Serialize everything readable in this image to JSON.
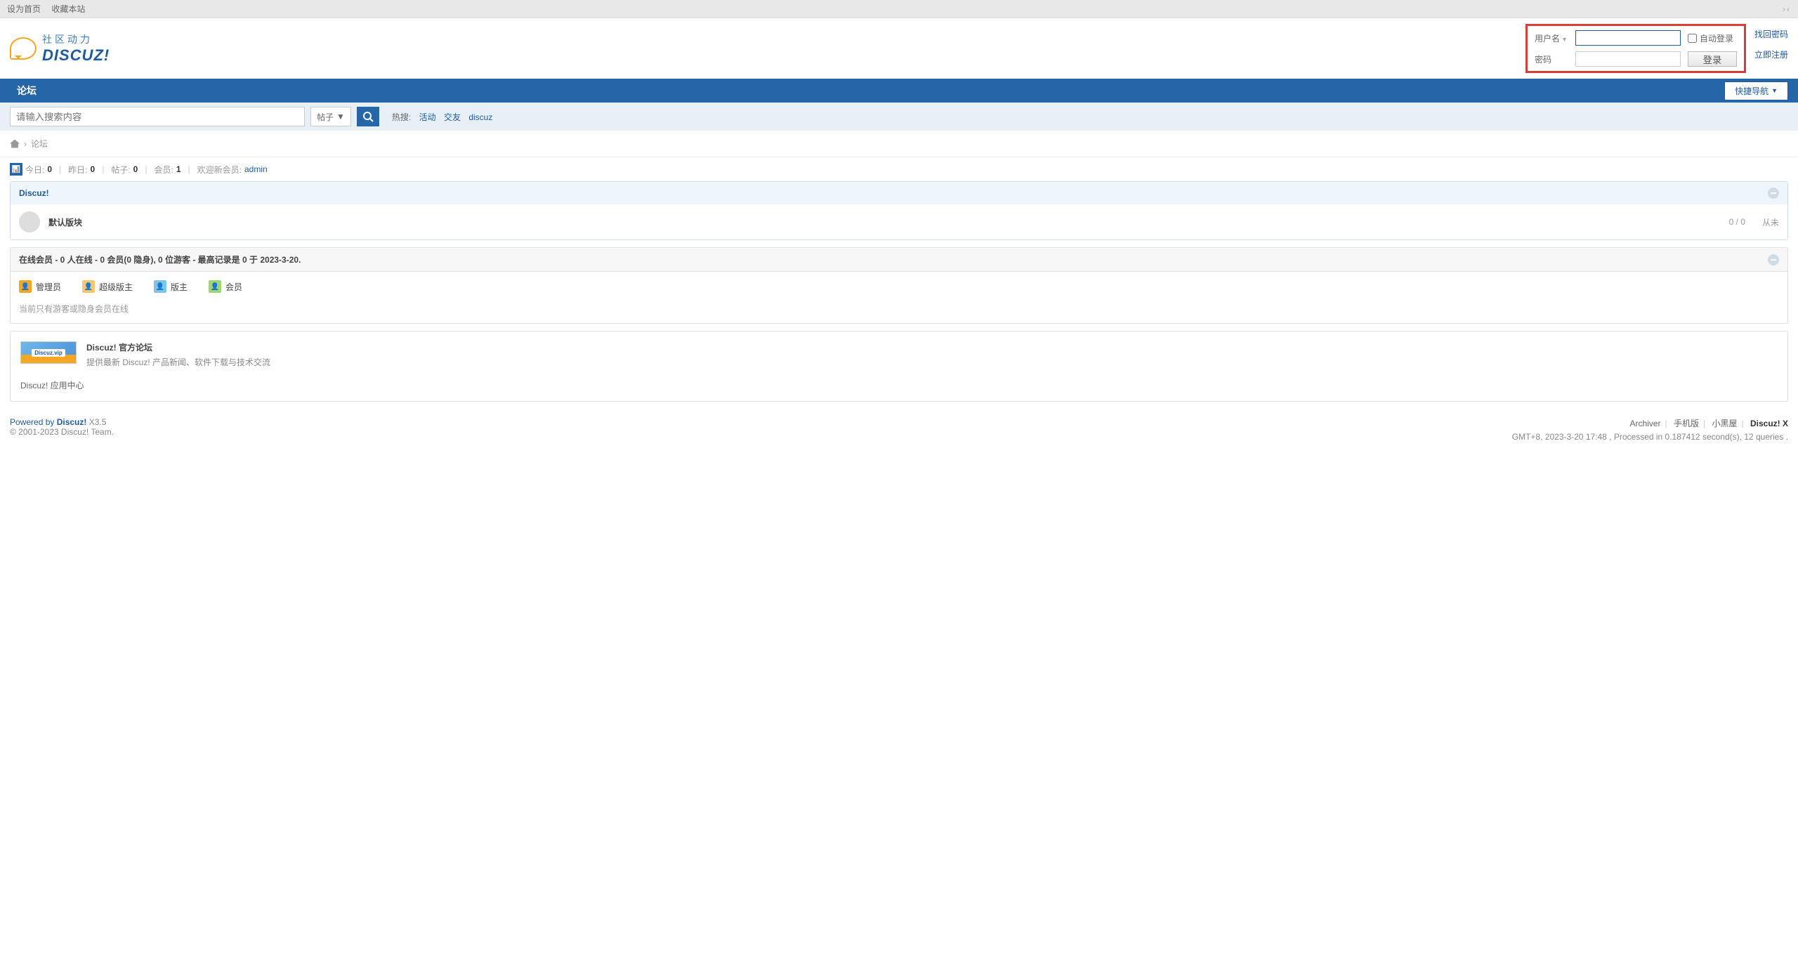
{
  "topbar": {
    "set_home": "设为首页",
    "favorite": "收藏本站",
    "toggle": "›‹"
  },
  "logo": {
    "cn": "社区动力",
    "en": "DISCUZ!"
  },
  "login": {
    "user_label": "用户名",
    "pwd_label": "密码",
    "auto": "自动登录",
    "btn": "登录",
    "forgot": "找回密码",
    "register": "立即注册"
  },
  "nav": {
    "forum": "论坛",
    "quick": "快捷导航"
  },
  "search": {
    "placeholder": "请输入搜索内容",
    "type": "帖子",
    "hot_label": "热搜:",
    "hots": [
      "活动",
      "交友",
      "discuz"
    ]
  },
  "breadcrumb": {
    "current": "论坛"
  },
  "stats": {
    "today_lbl": "今日:",
    "today_val": "0",
    "yest_lbl": "昨日:",
    "yest_val": "0",
    "posts_lbl": "帖子:",
    "posts_val": "0",
    "members_lbl": "会员:",
    "members_val": "1",
    "welcome_lbl": "欢迎新会员:",
    "welcome_name": "admin"
  },
  "category": {
    "name": "Discuz!",
    "forum_name": "默认版块",
    "count": "0 / 0",
    "last": "从未"
  },
  "online": {
    "title": "在线会员 - 0 人在线 - 0 会员(0 隐身), 0 位游客 - 最高记录是 0 于 2023-3-20.",
    "roles": {
      "admin": "管理员",
      "super": "超级版主",
      "mod": "版主",
      "mem": "会员"
    },
    "msg": "当前只有游客或隐身会员在线"
  },
  "official": {
    "badge": "Discuz.vip",
    "title": "Discuz! 官方论坛",
    "desc": "提供最新 Discuz! 产品新闻、软件下载与技术交流",
    "app_center": "Discuz! 应用中心"
  },
  "footer": {
    "powered": "Powered by ",
    "brand": "Discuz!",
    "ver": " X3.5",
    "copy": "© 2001-2023 Discuz! Team.",
    "links": {
      "archiver": "Archiver",
      "mobile": "手机版",
      "blacklist": "小黑屋",
      "dx": "Discuz! X"
    },
    "info": "GMT+8, 2023-3-20 17:48 , Processed in 0.187412 second(s), 12 queries ."
  }
}
